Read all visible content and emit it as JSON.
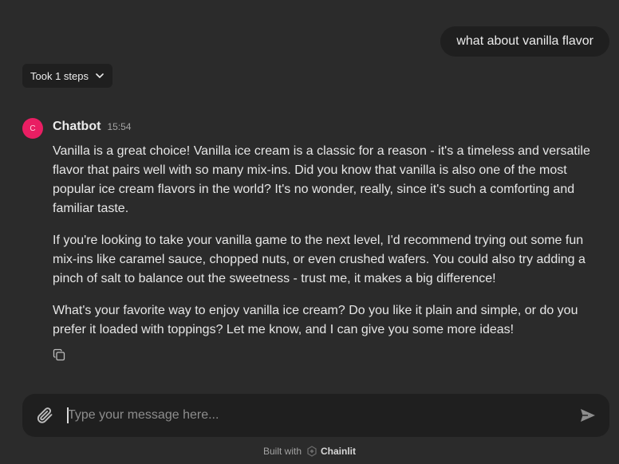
{
  "conversation": {
    "user_message": "what about vanilla flavor",
    "steps_label": "Took 1 steps",
    "bot": {
      "avatar_letter": "C",
      "avatar_color": "#e91e63",
      "name": "Chatbot",
      "time": "15:54",
      "paragraphs": [
        "Vanilla is a great choice! Vanilla ice cream is a classic for a reason - it's a timeless and versatile flavor that pairs well with so many mix-ins. Did you know that vanilla is also one of the most popular ice cream flavors in the world? It's no wonder, really, since it's such a comforting and familiar taste.",
        "If you're looking to take your vanilla game to the next level, I'd recommend trying out some fun mix-ins like caramel sauce, chopped nuts, or even crushed wafers. You could also try adding a pinch of salt to balance out the sweetness - trust me, it makes a big difference!",
        "What's your favorite way to enjoy vanilla ice cream? Do you like it plain and simple, or do you prefer it loaded with toppings? Let me know, and I can give you some more ideas!"
      ],
      "copy_icon": "copy-icon"
    }
  },
  "composer": {
    "placeholder": "Type your message here...",
    "value": "",
    "attach_icon": "paperclip-icon",
    "send_icon": "send-icon"
  },
  "footer": {
    "built_with": "Built with",
    "brand": "Chainlit"
  },
  "colors": {
    "background": "#2b2b2b",
    "surface": "#1f1f1f",
    "accent": "#e91e63"
  }
}
